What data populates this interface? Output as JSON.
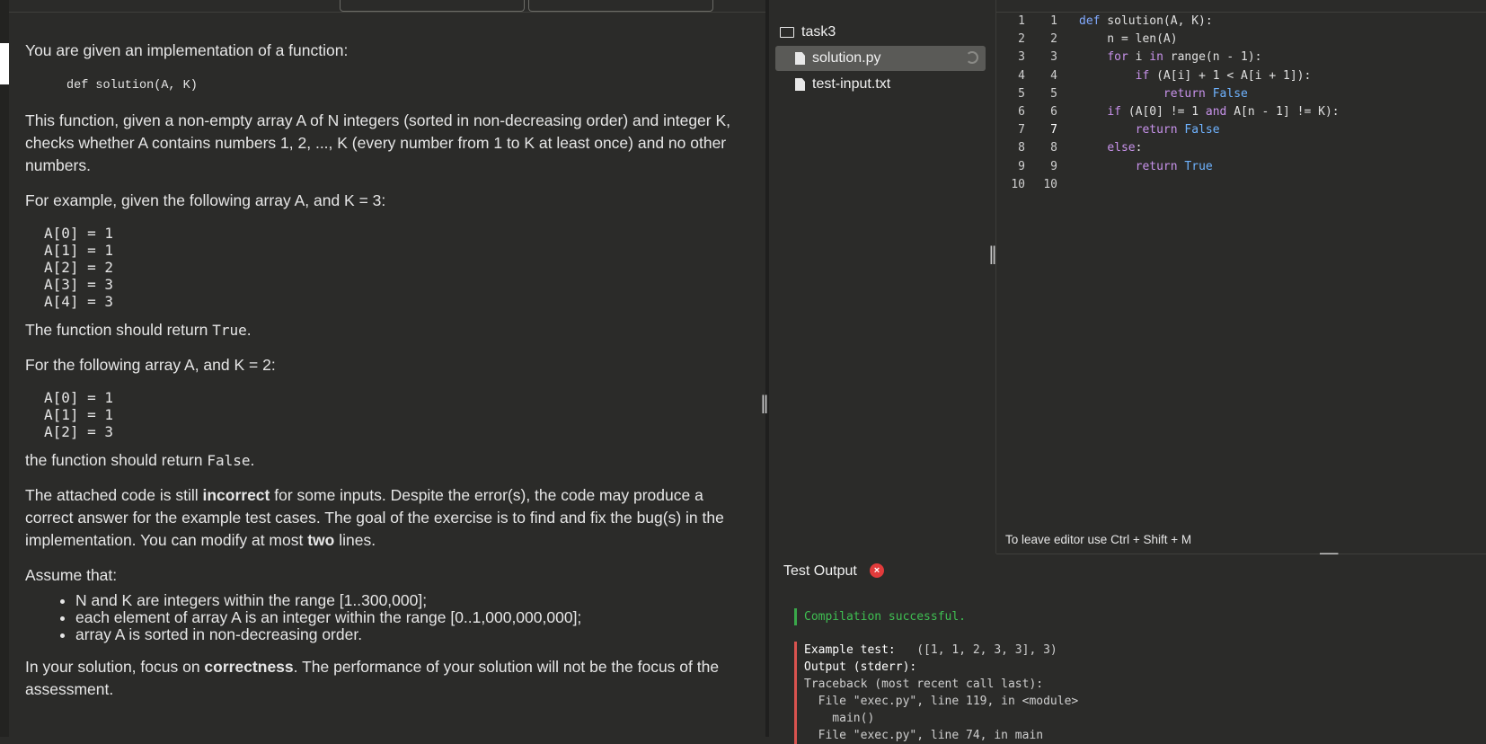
{
  "description": {
    "intro": "You are given an implementation of a function:",
    "signature": "def solution(A, K)",
    "para1": "This function, given a non-empty array A of N integers (sorted in non-decreasing order) and integer K, checks whether A contains numbers 1, 2, ..., K (every number from 1 to K at least once) and no other numbers.",
    "example1_intro": "For example, given the following array A, and K = 3:",
    "example1_array": "A[0] = 1\nA[1] = 1\nA[2] = 2\nA[3] = 3\nA[4] = 3",
    "example1_result_pre": "The function should return ",
    "example1_result_val": "True",
    "example2_intro": "For the following array A, and K = 2:",
    "example2_array": "A[0] = 1\nA[1] = 1\nA[2] = 3",
    "example2_result_pre": "the function should return ",
    "example2_result_val": "False",
    "para_bug_1": "The attached code is still ",
    "para_bug_bold": "incorrect",
    "para_bug_2": " for some inputs. Despite the error(s), the code may produce a correct answer for the example test cases. The goal of the exercise is to find and fix the bug(s) in the implementation. You can modify at most ",
    "para_bug_bold2": "two",
    "para_bug_3": " lines.",
    "assume": "Assume that:",
    "assumptions": [
      "N and K are integers within the range [1..300,000];",
      "each element of array A is an integer within the range [0..1,000,000,000];",
      "array A is sorted in non-decreasing order."
    ],
    "focus_1": "In your solution, focus on ",
    "focus_bold": "correctness",
    "focus_2": ". The performance of your solution will not be the focus of the assessment."
  },
  "tree": {
    "folder": "task3",
    "files": [
      "solution.py",
      "test-input.txt"
    ]
  },
  "editor": {
    "hint": "To leave editor use Ctrl + Shift + M"
  },
  "output": {
    "title": "Test Output",
    "badge": "×",
    "compile": "Compilation successful.",
    "example_label": "Example test:",
    "example_value": "   ([1, 1, 2, 3, 3], 3)",
    "stderr_label": "Output (stderr):",
    "traceback": "Traceback (most recent call last):\n  File \"exec.py\", line 119, in <module>\n    main()\n  File \"exec.py\", line 74, in main"
  }
}
